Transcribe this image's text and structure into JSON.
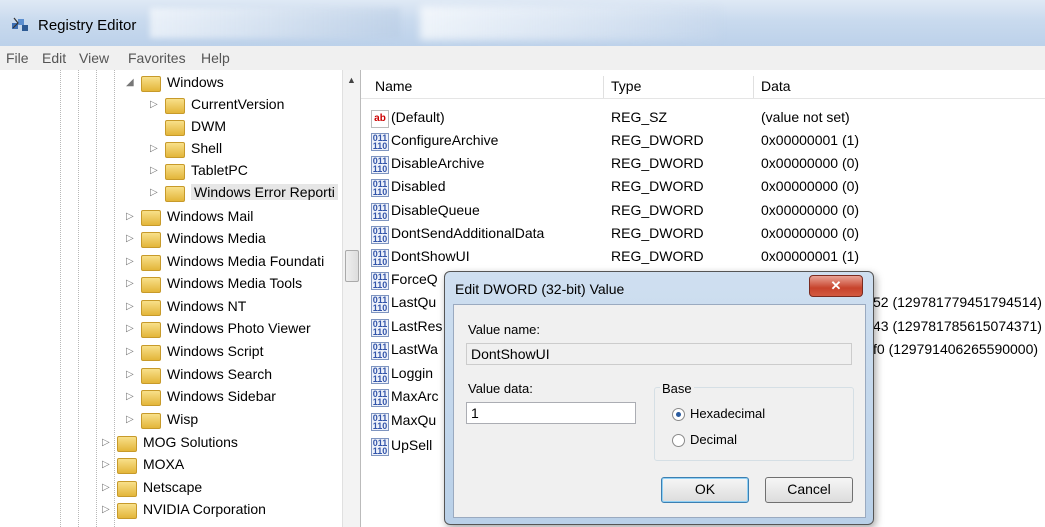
{
  "window": {
    "title": "Registry Editor"
  },
  "menu": [
    "File",
    "Edit",
    "View",
    "Favorites",
    "Help"
  ],
  "tree": [
    {
      "label": "Windows",
      "expander": "◢"
    },
    {
      "label": "CurrentVersion",
      "expander": "▷"
    },
    {
      "label": "DWM",
      "expander": ""
    },
    {
      "label": "Shell",
      "expander": "▷"
    },
    {
      "label": "TabletPC",
      "expander": "▷"
    },
    {
      "label": "Windows Error Reporti",
      "expander": "▷",
      "selected": true
    },
    {
      "label": "Windows Mail",
      "expander": "▷"
    },
    {
      "label": "Windows Media",
      "expander": "▷"
    },
    {
      "label": "Windows Media Foundati",
      "expander": "▷"
    },
    {
      "label": "Windows Media Tools",
      "expander": "▷"
    },
    {
      "label": "Windows NT",
      "expander": "▷"
    },
    {
      "label": "Windows Photo Viewer",
      "expander": "▷"
    },
    {
      "label": "Windows Script",
      "expander": "▷"
    },
    {
      "label": "Windows Search",
      "expander": "▷"
    },
    {
      "label": "Windows Sidebar",
      "expander": "▷"
    },
    {
      "label": "Wisp",
      "expander": "▷"
    },
    {
      "label": "MOG Solutions",
      "expander": "▷"
    },
    {
      "label": "MOXA",
      "expander": "▷"
    },
    {
      "label": "Netscape",
      "expander": "▷"
    },
    {
      "label": "NVIDIA Corporation",
      "expander": "▷"
    }
  ],
  "columns": {
    "name": "Name",
    "type": "Type",
    "data": "Data"
  },
  "values": [
    {
      "name": "(Default)",
      "type": "REG_SZ",
      "data": "(value not set)",
      "icon": "string-value-icon"
    },
    {
      "name": "ConfigureArchive",
      "type": "REG_DWORD",
      "data": "0x00000001 (1)",
      "icon": "dword-value-icon"
    },
    {
      "name": "DisableArchive",
      "type": "REG_DWORD",
      "data": "0x00000000 (0)",
      "icon": "dword-value-icon"
    },
    {
      "name": "Disabled",
      "type": "REG_DWORD",
      "data": "0x00000000 (0)",
      "icon": "dword-value-icon"
    },
    {
      "name": "DisableQueue",
      "type": "REG_DWORD",
      "data": "0x00000000 (0)",
      "icon": "dword-value-icon"
    },
    {
      "name": "DontSendAdditionalData",
      "type": "REG_DWORD",
      "data": "0x00000000 (0)",
      "icon": "dword-value-icon"
    },
    {
      "name": "DontShowUI",
      "type": "REG_DWORD",
      "data": "0x00000001 (1)",
      "icon": "dword-value-icon"
    },
    {
      "name": "ForceQ",
      "type": "",
      "data": "",
      "icon": "dword-value-icon"
    },
    {
      "name": "LastQu",
      "type": "",
      "data": "52 (129781779451794514)",
      "icon": "dword-value-icon"
    },
    {
      "name": "LastRes",
      "type": "",
      "data": "43 (129781785615074371)",
      "icon": "dword-value-icon"
    },
    {
      "name": "LastWa",
      "type": "",
      "data": "f0 (129791406265590000)",
      "icon": "dword-value-icon"
    },
    {
      "name": "Loggin",
      "type": "",
      "data": "",
      "icon": "dword-value-icon"
    },
    {
      "name": "MaxArc",
      "type": "",
      "data": "",
      "icon": "dword-value-icon"
    },
    {
      "name": "MaxQu",
      "type": "",
      "data": "",
      "icon": "dword-value-icon"
    },
    {
      "name": "UpSell",
      "type": "",
      "data": "",
      "icon": "dword-value-icon"
    }
  ],
  "dialog": {
    "title": "Edit DWORD (32-bit) Value",
    "close_glyph": "✕",
    "value_name_label": "Value name:",
    "value_name": "DontShowUI",
    "value_data_label": "Value data:",
    "value_data": "1",
    "base_label": "Base",
    "hex_label": "Hexadecimal",
    "dec_label": "Decimal",
    "selected_base": "Hexadecimal",
    "ok_label": "OK",
    "cancel_label": "Cancel"
  }
}
